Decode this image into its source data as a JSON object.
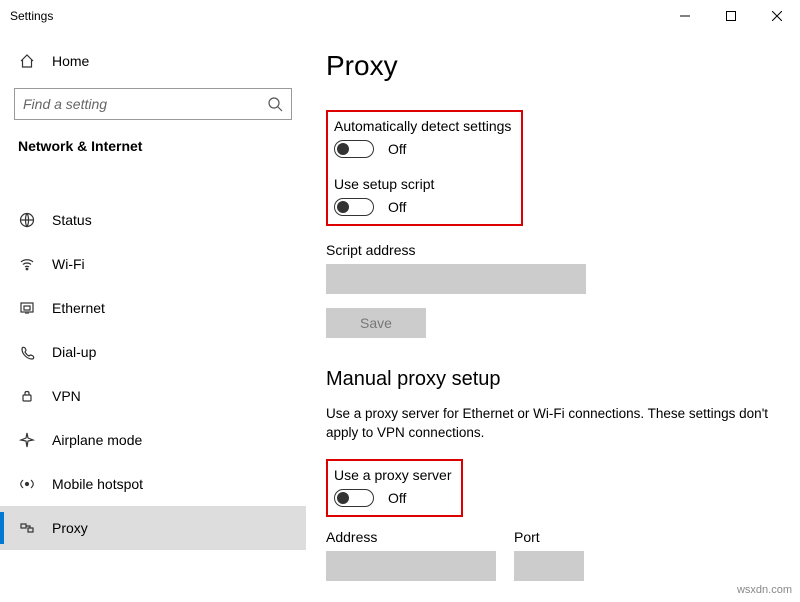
{
  "window": {
    "title": "Settings"
  },
  "sidebar": {
    "home": "Home",
    "search_placeholder": "Find a setting",
    "section": "Network & Internet",
    "items": [
      {
        "label": "Status"
      },
      {
        "label": "Wi-Fi"
      },
      {
        "label": "Ethernet"
      },
      {
        "label": "Dial-up"
      },
      {
        "label": "VPN"
      },
      {
        "label": "Airplane mode"
      },
      {
        "label": "Mobile hotspot"
      },
      {
        "label": "Proxy"
      }
    ]
  },
  "page": {
    "title": "Proxy",
    "auto_detect": {
      "label": "Automatically detect settings",
      "state": "Off"
    },
    "setup_script": {
      "label": "Use setup script",
      "state": "Off"
    },
    "script_address_label": "Script address",
    "save_label": "Save",
    "manual_title": "Manual proxy setup",
    "manual_desc": "Use a proxy server for Ethernet or Wi-Fi connections. These settings don't apply to VPN connections.",
    "use_proxy": {
      "label": "Use a proxy server",
      "state": "Off"
    },
    "address_label": "Address",
    "port_label": "Port"
  },
  "watermark": "wsxdn.com"
}
